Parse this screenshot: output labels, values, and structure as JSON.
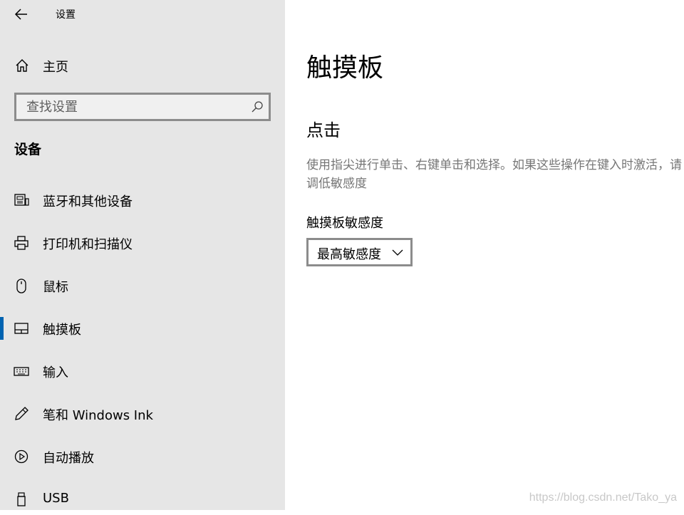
{
  "window": {
    "title": "设置"
  },
  "sidebar": {
    "home_label": "主页",
    "search_placeholder": "查找设置",
    "section_heading": "设备",
    "items": [
      {
        "label": "蓝牙和其他设备",
        "icon": "bluetooth-devices-icon"
      },
      {
        "label": "打印机和扫描仪",
        "icon": "printer-icon"
      },
      {
        "label": "鼠标",
        "icon": "mouse-icon"
      },
      {
        "label": "触摸板",
        "icon": "touchpad-icon",
        "active": true
      },
      {
        "label": "输入",
        "icon": "keyboard-icon"
      },
      {
        "label": "笔和 Windows Ink",
        "icon": "pen-icon"
      },
      {
        "label": "自动播放",
        "icon": "autoplay-icon"
      },
      {
        "label": "USB",
        "icon": "usb-icon"
      }
    ]
  },
  "main": {
    "title": "触摸板",
    "section_title": "点击",
    "description": "使用指尖进行单击、右键单击和选择。如果这些操作在键入时激活，请调低敏感度",
    "sensitivity_label": "触摸板敏感度",
    "sensitivity_value": "最高敏感度"
  },
  "watermark": "https://blog.csdn.net/Tako_ya",
  "colors": {
    "sidebar_bg": "#e6e6e6",
    "accent": "#0063b1",
    "description_text": "#767676"
  }
}
